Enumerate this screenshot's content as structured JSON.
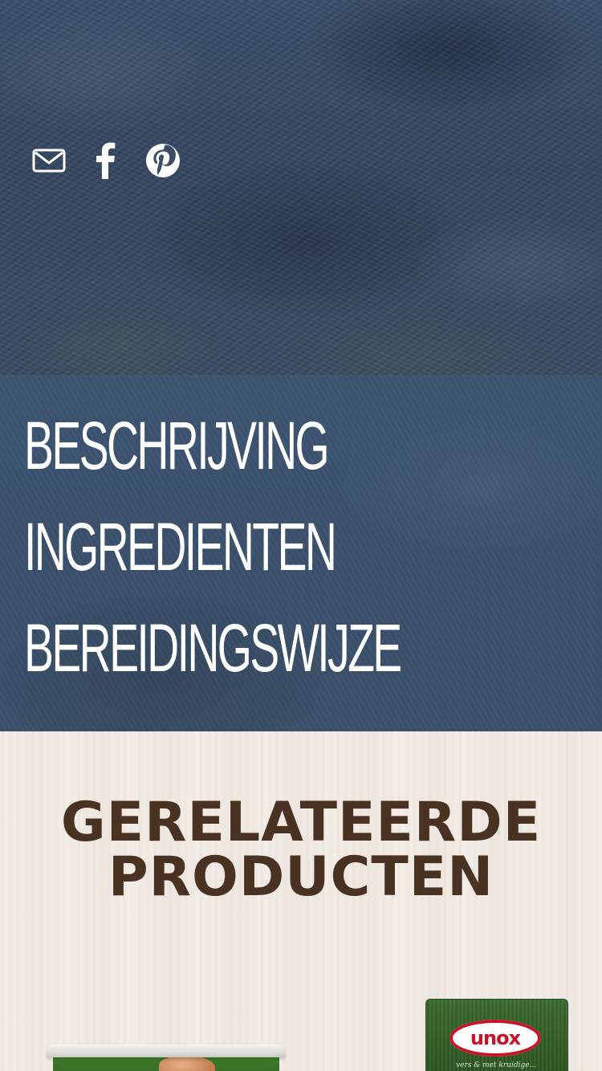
{
  "share": {
    "items": [
      {
        "id": "email",
        "icon": "mail-icon",
        "label": "E-mail"
      },
      {
        "id": "facebook",
        "icon": "facebook-icon",
        "label": "Facebook"
      },
      {
        "id": "pinterest",
        "icon": "pinterest-icon",
        "label": "Pinterest"
      }
    ],
    "icon_color": "#ffffff"
  },
  "menu": {
    "items": [
      {
        "label": "BESCHRIJVING"
      },
      {
        "label": "INGREDIENTEN"
      },
      {
        "label": "BEREIDINGSWIJZE"
      }
    ],
    "text_color": "#ffffff",
    "band_color": "#3b5069"
  },
  "related": {
    "title_line1": "GERELATEERDE",
    "title_line2": "PRODUCTEN",
    "title_color": "#4a3222",
    "products": [
      {
        "name": "product-tub",
        "brand": ""
      },
      {
        "name": "product-bag",
        "brand": "unox",
        "tagline": "vers & met kruidige..."
      }
    ]
  },
  "colors": {
    "hero_bg": "#37495f",
    "wood_bg": "#f4eee9",
    "unox_red": "#c8142a",
    "unox_green": "#2f5e24"
  }
}
